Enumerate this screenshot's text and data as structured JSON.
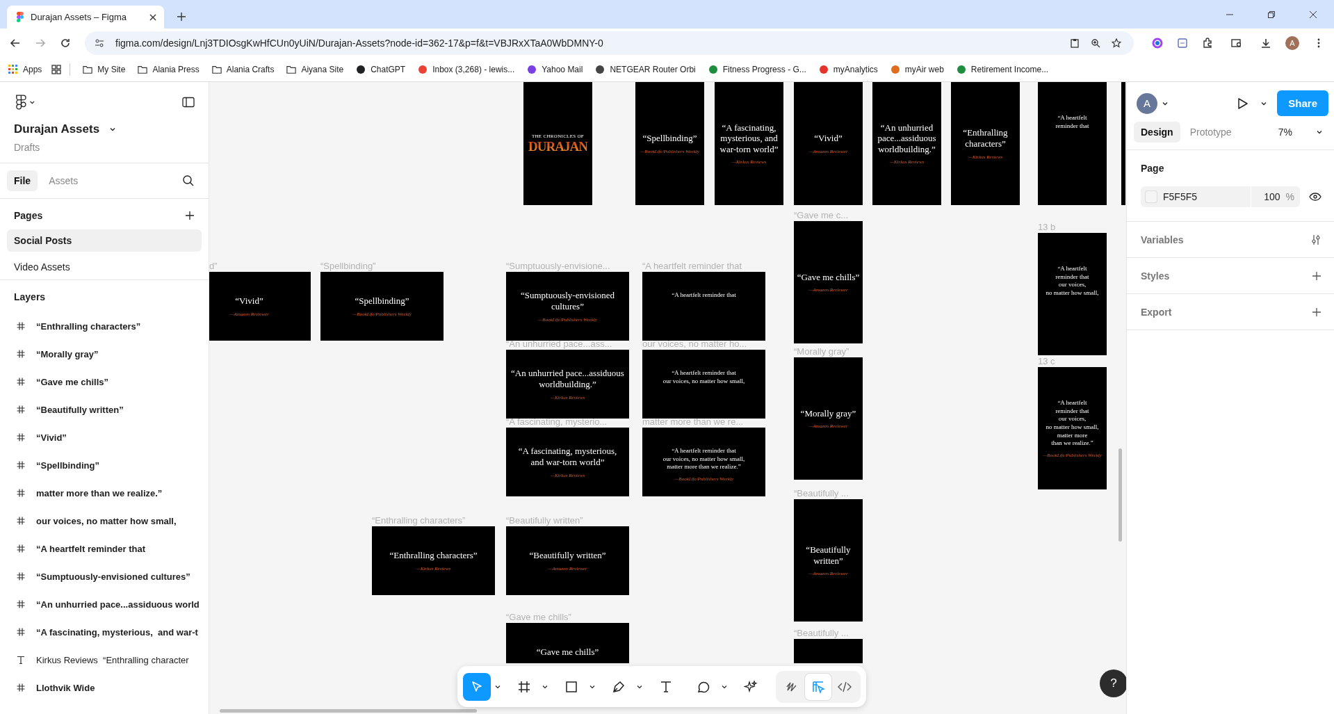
{
  "browser": {
    "tab": {
      "title": "Durajan Assets – Figma"
    },
    "url": "figma.com/design/Lnj3TDIOsgKwHfCUn0yUiN/Durajan-Assets?node-id=362-17&p=f&t=VBJRxXTaA0WbDMNY-0",
    "profile": "A",
    "bookmarks": [
      {
        "kind": "apps",
        "label": "Apps"
      },
      {
        "kind": "grid"
      },
      {
        "kind": "folder",
        "label": "My Site"
      },
      {
        "kind": "folder",
        "label": "Alania Press"
      },
      {
        "kind": "folder",
        "label": "Alania Crafts"
      },
      {
        "kind": "folder",
        "label": "Aiyana Site"
      },
      {
        "kind": "site",
        "label": "ChatGPT",
        "color": "#202123"
      },
      {
        "kind": "site",
        "label": "Inbox (3,268) - lewis...",
        "color": "#ea4335"
      },
      {
        "kind": "site",
        "label": "Yahoo Mail",
        "color": "#7b3fe4"
      },
      {
        "kind": "site",
        "label": "NETGEAR Router Orbi",
        "color": "#444444"
      },
      {
        "kind": "site",
        "label": "Fitness Progress - G...",
        "color": "#1e8e3e"
      },
      {
        "kind": "site",
        "label": "myAnalytics",
        "color": "#e5332a"
      },
      {
        "kind": "site",
        "label": "myAir web",
        "color": "#e06c1f"
      },
      {
        "kind": "site",
        "label": "Retirement Income...",
        "color": "#1e8e3e"
      }
    ]
  },
  "left_panel": {
    "file_name": "Durajan Assets",
    "location": "Drafts",
    "tabs": [
      {
        "label": "File",
        "selected": true
      },
      {
        "label": "Assets",
        "selected": false
      }
    ],
    "pages_heading": "Pages",
    "pages": [
      {
        "label": "Social Posts",
        "selected": true
      },
      {
        "label": "Video Assets",
        "selected": false
      }
    ],
    "layers_heading": "Layers",
    "layers": [
      {
        "kind": "frame",
        "name": "“Enthralling characters”"
      },
      {
        "kind": "frame",
        "name": "“Morally gray”"
      },
      {
        "kind": "frame",
        "name": "“Gave me chills”"
      },
      {
        "kind": "frame",
        "name": "“Beautifully written”"
      },
      {
        "kind": "frame",
        "name": "“Vivid”"
      },
      {
        "kind": "frame",
        "name": "“Spellbinding”"
      },
      {
        "kind": "frame",
        "name": "matter more than we realize.”"
      },
      {
        "kind": "frame",
        "name": "our voices, no matter how small,"
      },
      {
        "kind": "frame",
        "name": "“A heartfelt reminder that"
      },
      {
        "kind": "frame",
        "name": "“Sumptuously-envisioned cultures”"
      },
      {
        "kind": "frame",
        "name": "“An unhurried pace...assiduous world"
      },
      {
        "kind": "frame",
        "name": "“A fascinating, mysterious,  and war-t"
      },
      {
        "kind": "text",
        "name": "Kirkus Reviews  “Enthralling character"
      },
      {
        "kind": "frame",
        "name": "Llothvik Wide"
      }
    ]
  },
  "canvas": {
    "frames": [
      {
        "kind": "cover",
        "kicker": "THE CHRONICLES OF",
        "title": "DURAJAN"
      },
      {
        "kind": "quote",
        "lines": [
          "“Spellbinding”"
        ],
        "attribution": "—BookLife/Publishers Weekly"
      },
      {
        "kind": "quote",
        "lines": [
          "“A fascinating,",
          "mysterious, and",
          "war-torn world”"
        ],
        "attribution": "—Kirkus Reviews"
      },
      {
        "kind": "quote",
        "lines": [
          "“Vivid”"
        ],
        "attribution": "—Amazon Reviewer"
      },
      {
        "kind": "quote",
        "lines": [
          "“An unhurried",
          "pace...assiduous",
          "worldbuilding.”"
        ],
        "attribution": "—Kirkus Reviews"
      },
      {
        "kind": "quote",
        "lines": [
          "“Enthralling",
          "characters”"
        ],
        "attribution": "—Kirkus Reviews"
      },
      {
        "kind": "sequence",
        "lines": [
          "“A heartfelt",
          "reminder that"
        ]
      },
      {
        "kind": "blank"
      },
      {
        "kind": "quote",
        "label": "“Gave me c...",
        "lines": [
          "“Gave me chills”"
        ],
        "attribution": "—Amazon Reviewer"
      },
      {
        "kind": "sequence",
        "label": "13 b",
        "lines": [
          "“A heartfelt",
          "reminder that",
          "our voices,",
          "no matter how small,"
        ]
      },
      {
        "kind": "quote",
        "label": "“Morally gray”",
        "lines": [
          "“Morally gray”"
        ],
        "attribution": "—Amazon Reviewer"
      },
      {
        "kind": "sequence",
        "label": "13 c",
        "lines": [
          "“A heartfelt",
          "reminder that",
          "our voices,",
          "no matter how small,",
          "matter more",
          "than we realize.”"
        ],
        "attribution": "—BookLife/Publishers Weekly"
      },
      {
        "kind": "quote",
        "label": "“Beautifully ...",
        "lines": [
          "“Beautifully",
          "written”"
        ],
        "attribution": "—Amazon Reviewer"
      },
      {
        "kind": "blank",
        "label": "“Beautifully ..."
      },
      {
        "kind": "quote",
        "label": "d”",
        "lines": [
          "“Vivid”"
        ],
        "attribution": "—Amazon Reviewer"
      },
      {
        "kind": "quote",
        "label": "“Spellbinding”",
        "lines": [
          "“Spellbinding”"
        ],
        "attribution": "—BookLife/Publishers Weekly"
      },
      {
        "kind": "quote",
        "label": "“Sumptuously-envisione...",
        "lines": [
          "“Sumptuously-envisioned",
          "cultures”"
        ],
        "attribution": "—BookLife/Publishers Weekly"
      },
      {
        "kind": "sequence",
        "label": "“A heartfelt reminder that",
        "lines": [
          "“A heartfelt reminder that"
        ]
      },
      {
        "kind": "quote",
        "label": "“An unhurried pace...ass...",
        "lines": [
          "“An unhurried pace...assiduous",
          "worldbuilding.”"
        ],
        "attribution": "—Kirkus Reviews"
      },
      {
        "kind": "sequence",
        "label": "our voices, no matter ho...",
        "lines": [
          "“A heartfelt reminder that",
          "our voices, no matter how small,"
        ]
      },
      {
        "kind": "quote",
        "label": "“A fascinating, mysterio...",
        "lines": [
          "“A fascinating, mysterious,",
          "and war-torn world”"
        ],
        "attribution": "—Kirkus Reviews"
      },
      {
        "kind": "sequence",
        "label": "matter more than we re...",
        "lines": [
          "“A heartfelt reminder that",
          "our voices, no matter how small,",
          "matter more than we realize.”"
        ],
        "attribution": "—BookLife/Publishers Weekly"
      },
      {
        "kind": "quote",
        "label": "“Enthralling characters”",
        "lines": [
          "“Enthralling characters”"
        ],
        "attribution": "—Kirkus Reviews"
      },
      {
        "kind": "quote",
        "label": "“Beautifully written”",
        "lines": [
          "“Beautifully written”"
        ],
        "attribution": "—Amazon Reviewer"
      },
      {
        "kind": "quote",
        "label": "“Gave me chills”",
        "lines": [
          "“Gave me chills”"
        ]
      }
    ]
  },
  "toolbar": {
    "tools": [
      {
        "kind": "move",
        "selected": true,
        "menu": true
      },
      {
        "kind": "frame",
        "selected": false,
        "menu": true
      },
      {
        "kind": "rectangle",
        "selected": false,
        "menu": true
      },
      {
        "kind": "pen",
        "selected": false,
        "menu": true
      },
      {
        "kind": "text",
        "selected": false,
        "menu": false
      },
      {
        "kind": "comment",
        "selected": false,
        "menu": true
      },
      {
        "kind": "ai",
        "selected": false,
        "menu": false
      }
    ],
    "modes": [
      {
        "kind": "draw",
        "selected": false
      },
      {
        "kind": "design",
        "selected": true
      },
      {
        "kind": "dev",
        "selected": false
      }
    ]
  },
  "help": "?",
  "right_panel": {
    "avatar": "A",
    "share": "Share",
    "tabs": [
      {
        "label": "Design",
        "selected": true
      },
      {
        "label": "Prototype",
        "selected": false
      }
    ],
    "zoom": "7%",
    "page_heading": "Page",
    "page_color": "F5F5F5",
    "opacity": "100",
    "opacity_unit": "%",
    "sections": [
      {
        "kind": "variables",
        "label": "Variables"
      },
      {
        "kind": "styles",
        "label": "Styles"
      },
      {
        "kind": "export",
        "label": "Export"
      }
    ]
  }
}
